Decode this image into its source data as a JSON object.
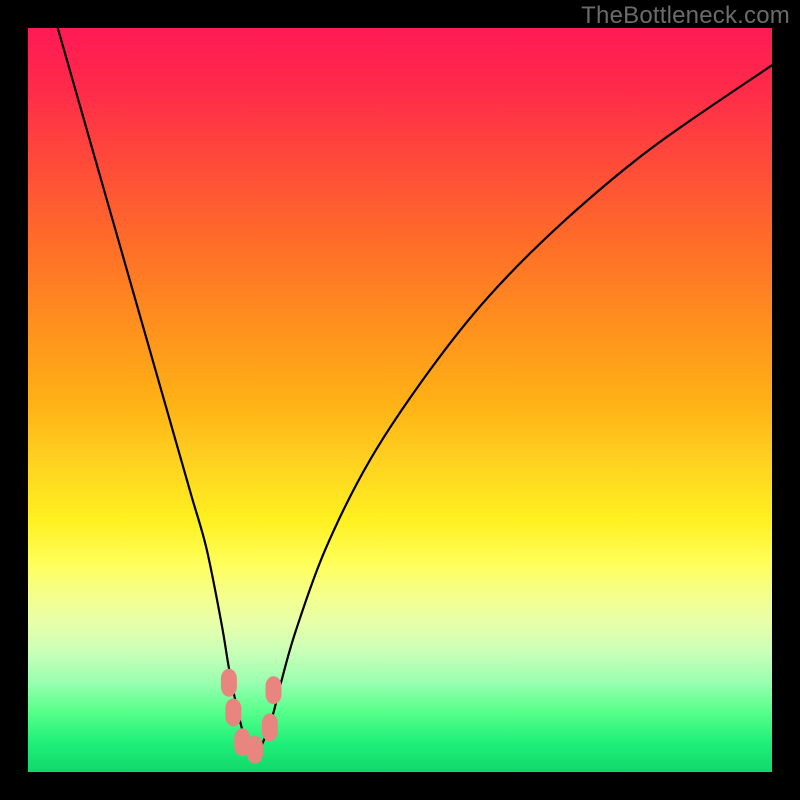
{
  "watermark": "TheBottleneck.com",
  "chart_data": {
    "type": "line",
    "title": "",
    "xlabel": "",
    "ylabel": "",
    "xlim": [
      0,
      100
    ],
    "ylim": [
      0,
      100
    ],
    "series": [
      {
        "name": "bottleneck-curve",
        "x": [
          4,
          6,
          8,
          10,
          12,
          14,
          16,
          18,
          20,
          22,
          24,
          26,
          27,
          28,
          29,
          30,
          31,
          32,
          33,
          34,
          36,
          40,
          46,
          54,
          62,
          72,
          84,
          100
        ],
        "values": [
          100,
          93,
          86,
          79,
          72,
          65,
          58,
          51,
          44,
          37,
          30,
          20,
          14,
          9,
          5,
          3,
          3,
          5,
          8,
          12,
          19,
          30,
          42,
          54,
          64,
          74,
          84,
          95
        ]
      }
    ],
    "markers": [
      {
        "name": "left-marker-1",
        "x": 27.0,
        "y": 12.0
      },
      {
        "name": "left-marker-2",
        "x": 27.6,
        "y": 8.0
      },
      {
        "name": "bottom-marker-1",
        "x": 28.8,
        "y": 4.0
      },
      {
        "name": "bottom-marker-2",
        "x": 30.5,
        "y": 3.0
      },
      {
        "name": "right-marker-1",
        "x": 32.5,
        "y": 6.0
      },
      {
        "name": "right-marker-2",
        "x": 33.0,
        "y": 11.0
      }
    ],
    "marker_color": "#e8857f",
    "curve_color": "#000000",
    "background_gradient": {
      "top": "#ff1a55",
      "mid": "#ffd020",
      "bottom": "#10d86a"
    }
  }
}
